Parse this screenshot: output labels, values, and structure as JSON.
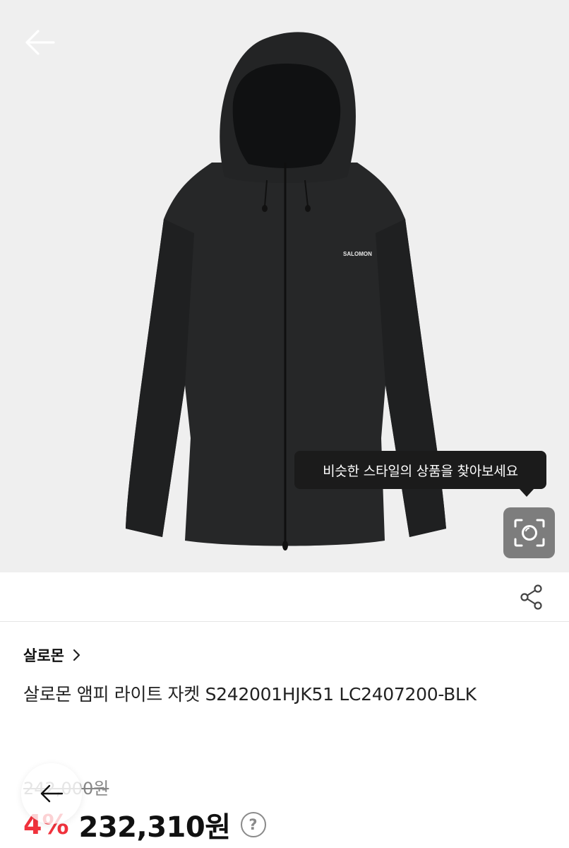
{
  "image": {
    "subject": "black hooded jacket",
    "logo_text": "SALOMON"
  },
  "icons": {
    "back": "arrow-left-icon",
    "lens": "visual-search-camera-icon",
    "share": "share-icon",
    "brand_chevron": "chevron-right-icon",
    "help": "question-circle-icon",
    "floating_back": "arrow-left-icon"
  },
  "tooltip": {
    "text": "비슷한 스타일의 상품을 찾아보세요"
  },
  "product": {
    "brand": "살로몬",
    "title": "살로몬 앰피 라이트 자켓 S242001HJK51 LC2407200-BLK",
    "original_price": "242,000원",
    "discount": "4%",
    "price": "232,310원"
  },
  "colors": {
    "discount_red": "#f0323c",
    "tooltip_bg": "#1b1b1b",
    "lens_button_bg": "#7d7d7d",
    "hero_bg": "#efefef"
  }
}
